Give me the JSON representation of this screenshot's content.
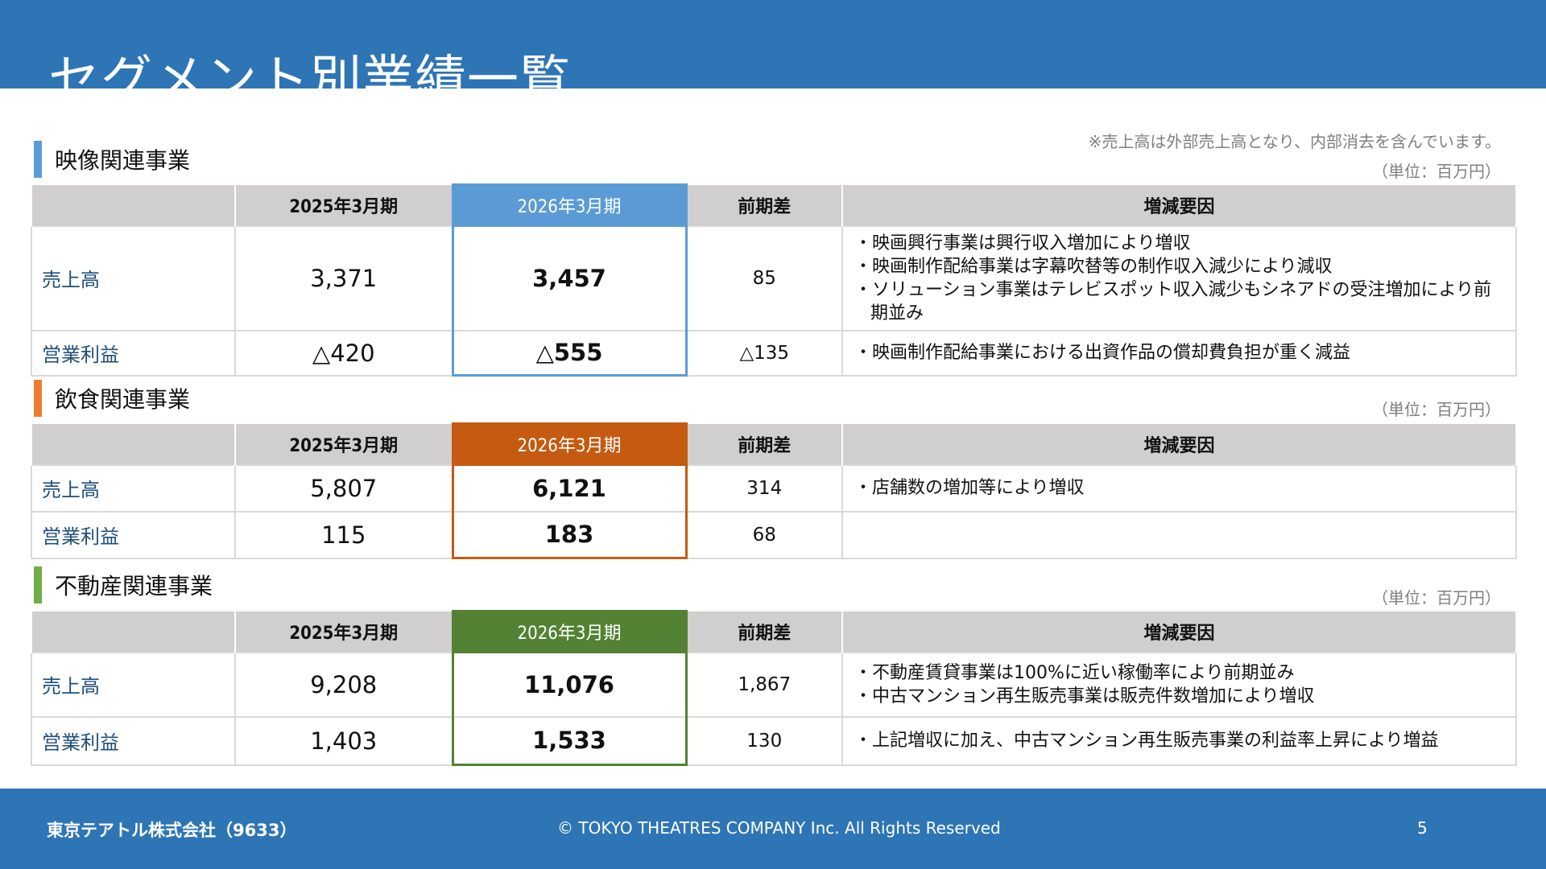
{
  "page": {
    "title": "セグメント別業績一覧",
    "note": "※売上高は外部売上高となり、内部消去を含んでいます。",
    "unit_label": "（単位：百万円）"
  },
  "columns": {
    "label": "",
    "prev": "2025年3月期",
    "curr": "2026年3月期",
    "diff": "前期差",
    "reason": "増減要因"
  },
  "sections": [
    {
      "title": "映像関連事業",
      "accent_color": "#5b9bd5",
      "rows": [
        {
          "label": "売上高",
          "prev": "3,371",
          "curr": "3,457",
          "diff": "85",
          "reasons": [
            "・映画興行事業は興行収入増加により増収",
            "・映画制作配給事業は字幕吹替等の制作収入減少により減収",
            "・ソリューション事業はテレビスポット収入減少もシネアドの受注増加により前期並み"
          ]
        },
        {
          "label": "営業利益",
          "prev": "△420",
          "curr": "△555",
          "diff": "△135",
          "reasons": [
            "・映画制作配給事業における出資作品の償却費負担が重く減益"
          ]
        }
      ]
    },
    {
      "title": "飲食関連事業",
      "accent_color": "#c55a11",
      "rows": [
        {
          "label": "売上高",
          "prev": "5,807",
          "curr": "6,121",
          "diff": "314",
          "reasons": [
            "・店舗数の増加等により増収"
          ]
        },
        {
          "label": "営業利益",
          "prev": "115",
          "curr": "183",
          "diff": "68",
          "reasons": []
        }
      ]
    },
    {
      "title": "不動産関連事業",
      "accent_color": "#548235",
      "rows": [
        {
          "label": "売上高",
          "prev": "9,208",
          "curr": "11,076",
          "diff": "1,867",
          "reasons": [
            "・不動産賃貸事業は100%に近い稼働率により前期並み",
            "・中古マンション再生販売事業は販売件数増加により増収"
          ]
        },
        {
          "label": "営業利益",
          "prev": "1,403",
          "curr": "1,533",
          "diff": "130",
          "reasons": [
            "・上記増収に加え、中古マンション再生販売事業の利益率上昇により増益"
          ]
        }
      ]
    }
  ],
  "footer": {
    "company": "東京テアトル株式会社（9633）",
    "copyright": "© TOKYO THEATRES COMPANY Inc. All Rights Reserved",
    "page_number": "5"
  },
  "colors": {
    "header_bg": "#2e75b6",
    "table_header_bg": "#d0cece",
    "row_label_text": "#1f4e79"
  }
}
